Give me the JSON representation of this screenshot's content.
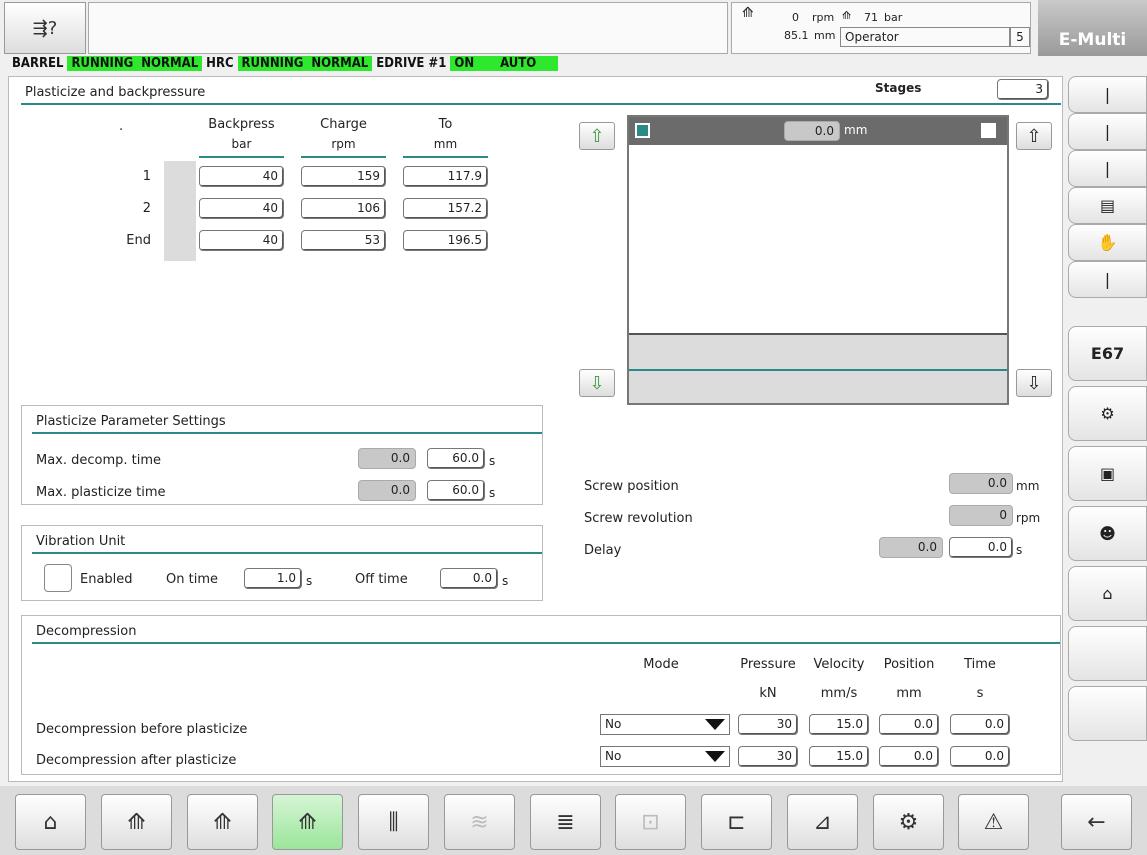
{
  "header": {
    "readouts": {
      "rpm_val": "0",
      "rpm_unit": "rpm",
      "pressure_val": "71",
      "pressure_unit": "bar",
      "pos_val": "85.1",
      "pos_unit": "mm",
      "user": "Operator",
      "level": "5"
    },
    "brand": "E-Multi"
  },
  "status": {
    "barrel": "BARREL",
    "barrel_run": "RUNNING",
    "barrel_mode": "NORMAL",
    "hrc": "HRC",
    "hrc_run": "RUNNING",
    "hrc_mode": "NORMAL",
    "edrive": "EDRIVE #1",
    "edrive_state": "ON",
    "edrive_mode": "AUTO"
  },
  "plasticize": {
    "title": "Plasticize and backpressure",
    "stages_label": "Stages",
    "stages": "3",
    "dot": ".",
    "col_backpress": "Backpress",
    "col_backpress_unit": "bar",
    "col_charge": "Charge",
    "col_charge_unit": "rpm",
    "col_to": "To",
    "col_to_unit": "mm",
    "rows": [
      {
        "label": "1",
        "backpress": "40",
        "charge": "159",
        "to": "117.9"
      },
      {
        "label": "2",
        "backpress": "40",
        "charge": "106",
        "to": "157.2"
      },
      {
        "label": "End",
        "backpress": "40",
        "charge": "53",
        "to": "196.5"
      }
    ],
    "graph_value": "0.0",
    "graph_unit": "mm"
  },
  "params": {
    "title": "Plasticize Parameter Settings",
    "decomp_label": "Max. decomp. time",
    "decomp_act": "0.0",
    "decomp_set": "60.0",
    "plast_label": "Max. plasticize time",
    "plast_act": "0.0",
    "plast_set": "60.0",
    "unit_s": "s"
  },
  "vibration": {
    "title": "Vibration Unit",
    "enabled": "Enabled",
    "on_time": "On time",
    "on_val": "1.0",
    "off_time": "Off time",
    "off_val": "0.0",
    "unit_s": "s"
  },
  "screw": {
    "pos_label": "Screw position",
    "pos_val": "0.0",
    "pos_unit": "mm",
    "rev_label": "Screw revolution",
    "rev_val": "0",
    "rev_unit": "rpm",
    "delay_label": "Delay",
    "delay_act": "0.0",
    "delay_set": "0.0",
    "delay_unit": "s"
  },
  "decomp": {
    "title": "Decompression",
    "col_mode": "Mode",
    "col_pressure": "Pressure",
    "col_velocity": "Velocity",
    "col_position": "Position",
    "col_time": "Time",
    "u_pressure": "kN",
    "u_velocity": "mm/s",
    "u_position": "mm",
    "u_time": "s",
    "rows": [
      {
        "label": "Decompression before plasticize",
        "mode": "No",
        "pressure": "30",
        "velocity": "15.0",
        "position": "0.0",
        "time": "0.0"
      },
      {
        "label": "Decompression after plasticize",
        "mode": "No",
        "pressure": "30",
        "velocity": "15.0",
        "position": "0.0",
        "time": "0.0"
      }
    ]
  },
  "side": {
    "e67": "E67"
  }
}
